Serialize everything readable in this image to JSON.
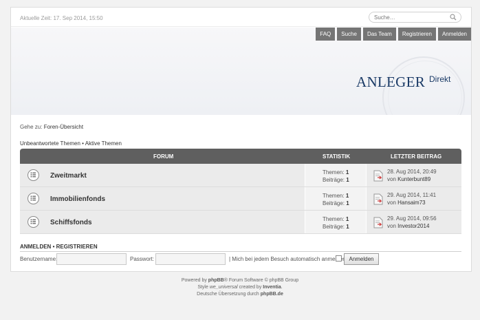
{
  "header": {
    "time": "Aktuelle Zeit: 17. Sep 2014, 15:50",
    "search_placeholder": "Suche…"
  },
  "menu": [
    "FAQ",
    "Suche",
    "Das Team",
    "Registrieren",
    "Anmelden"
  ],
  "logo": {
    "main": "ANLEGER",
    "sub": "Direkt"
  },
  "jump": {
    "prefix": "Gehe zu:",
    "link": "Foren-Übersicht"
  },
  "quicklinks": {
    "unanswered": "Unbeantwortete Themen",
    "sep": "•",
    "active": "Aktive Themen"
  },
  "table": {
    "headers": {
      "forum": "FORUM",
      "stats": "STATISTIK",
      "last": "LETZTER BEITRAG"
    },
    "rows": [
      {
        "title": "Zweitmarkt",
        "topics_label": "Themen:",
        "topics": "1",
        "posts_label": "Beiträge:",
        "posts": "1",
        "date": "28. Aug 2014, 20:49",
        "by": "von",
        "user": "Kunterbunt89"
      },
      {
        "title": "Immobilienfonds",
        "topics_label": "Themen:",
        "topics": "1",
        "posts_label": "Beiträge:",
        "posts": "1",
        "date": "29. Aug 2014, 11:41",
        "by": "von",
        "user": "Hansaim73"
      },
      {
        "title": "Schiffsfonds",
        "topics_label": "Themen:",
        "topics": "1",
        "posts_label": "Beiträge:",
        "posts": "1",
        "date": "29. Aug 2014, 09:56",
        "by": "von",
        "user": "Investor2014"
      }
    ]
  },
  "login": {
    "heading_login": "ANMELDEN",
    "heading_sep": "•",
    "heading_register": "REGISTRIEREN",
    "username_label": "Benutzername:",
    "password_label": "Passwort:",
    "remember_label": "| Mich bei jedem Besuch automatisch anmelden",
    "button": "Anmelden"
  },
  "footer": {
    "line1_a": "Powered by",
    "line1_b": "phpBB",
    "line1_c": "® Forum Software © phpBB Group",
    "line2_a": "Style",
    "line2_b": "we_universal",
    "line2_c": "created by",
    "line2_d": "Inventia",
    "line2_e": ".",
    "line3_a": "Deutsche Übersetzung durch",
    "line3_b": "phpBB.de"
  },
  "colors": {
    "header_bar": "#5f5f5f",
    "menu_item": "#757575",
    "logo": "#1a3a66"
  }
}
